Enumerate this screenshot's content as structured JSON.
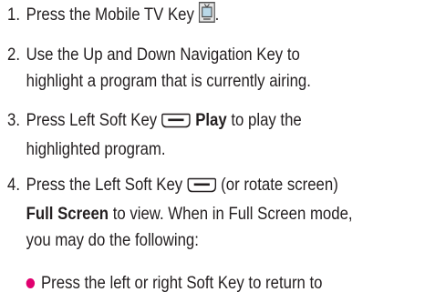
{
  "steps": [
    {
      "num": "1.",
      "l1_pre": "Press the Mobile TV Key",
      "l1_post": "."
    },
    {
      "num": "2.",
      "l1": "Use the Up and Down Navigation Key to",
      "l2": "highlight a program that is currently airing."
    },
    {
      "num": "3.",
      "l1_pre": "Press Left Soft Key",
      "l1_bold": "Play",
      "l1_post": "to play the",
      "l2": "highlighted program."
    },
    {
      "num": "4.",
      "l1_pre": "Press the Left Soft Key",
      "l1_post": "(or rotate screen)",
      "l2_bold": "Full Screen",
      "l2_post": "to view. When in Full Screen mode,",
      "l3": "you may do the following:"
    }
  ],
  "bullets": [
    "Press the left or right Soft Key to return to"
  ],
  "colors": {
    "text": "#231f20",
    "bullet": "#e0006f",
    "icon_fill": "#b9d8e8"
  },
  "icons": {
    "tv_key": "mobile-tv-key-icon",
    "soft_key": "left-soft-key-icon"
  }
}
